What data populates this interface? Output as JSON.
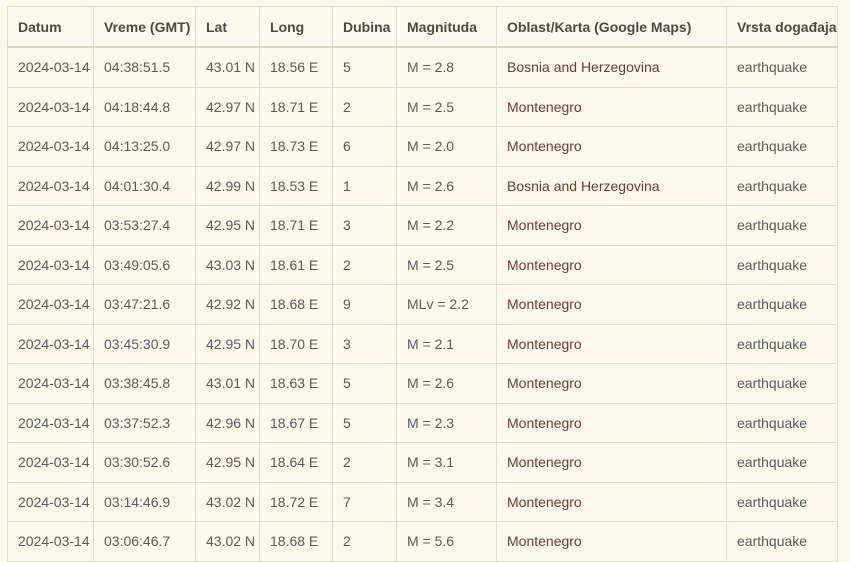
{
  "table": {
    "headers": [
      "Datum",
      "Vreme (GMT)",
      "Lat",
      "Long",
      "Dubina",
      "Magnituda",
      "Oblast/Karta (Google Maps)",
      "Vrsta događaja"
    ],
    "rows": [
      [
        "2024-03-14",
        "04:38:51.5",
        "43.01 N",
        "18.56 E",
        "5",
        "M = 2.8",
        "Bosnia and Herzegovina",
        "earthquake"
      ],
      [
        "2024-03-14",
        "04:18:44.8",
        "42.97 N",
        "18.71 E",
        "2",
        "M = 2.5",
        "Montenegro",
        "earthquake"
      ],
      [
        "2024-03-14",
        "04:13:25.0",
        "42.97 N",
        "18.73 E",
        "6",
        "M = 2.0",
        "Montenegro",
        "earthquake"
      ],
      [
        "2024-03-14",
        "04:01:30.4",
        "42.99 N",
        "18.53 E",
        "1",
        "M = 2.6",
        "Bosnia and Herzegovina",
        "earthquake"
      ],
      [
        "2024-03-14",
        "03:53:27.4",
        "42.95 N",
        "18.71 E",
        "3",
        "M = 2.2",
        "Montenegro",
        "earthquake"
      ],
      [
        "2024-03-14",
        "03:49:05.6",
        "43.03 N",
        "18.61 E",
        "2",
        "M = 2.5",
        "Montenegro",
        "earthquake"
      ],
      [
        "2024-03-14",
        "03:47:21.6",
        "42.92 N",
        "18.68 E",
        "9",
        "MLv = 2.2",
        "Montenegro",
        "earthquake"
      ],
      [
        "2024-03-14",
        "03:45:30.9",
        "42.95 N",
        "18.70 E",
        "3",
        "M = 2.1",
        "Montenegro",
        "earthquake"
      ],
      [
        "2024-03-14",
        "03:38:45.8",
        "43.01 N",
        "18.63 E",
        "5",
        "M = 2.6",
        "Montenegro",
        "earthquake"
      ],
      [
        "2024-03-14",
        "03:37:52.3",
        "42.96 N",
        "18.67 E",
        "5",
        "M = 2.3",
        "Montenegro",
        "earthquake"
      ],
      [
        "2024-03-14",
        "03:30:52.6",
        "42.95 N",
        "18.64 E",
        "2",
        "M = 3.1",
        "Montenegro",
        "earthquake"
      ],
      [
        "2024-03-14",
        "03:14:46.9",
        "43.02 N",
        "18.72 E",
        "7",
        "M = 3.4",
        "Montenegro",
        "earthquake"
      ],
      [
        "2024-03-14",
        "03:06:46.7",
        "43.02 N",
        "18.68 E",
        "2",
        "M = 5.6",
        "Montenegro",
        "earthquake"
      ]
    ]
  }
}
